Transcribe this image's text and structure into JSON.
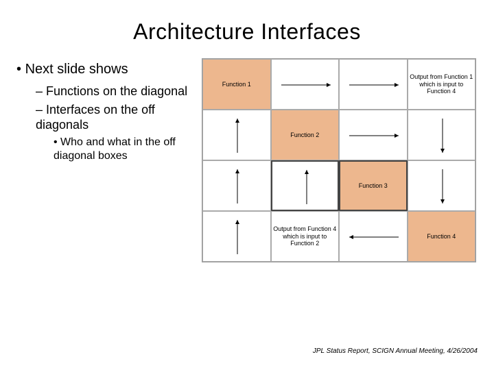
{
  "title": "Architecture Interfaces",
  "bullets": {
    "b1": "Next slide shows",
    "b2a": "Functions on the diagonal",
    "b2b": "Interfaces on the off diagonals",
    "b3": "Who and what in the off diagonal boxes"
  },
  "grid": {
    "f1": "Function 1",
    "f2": "Function 2",
    "f3": "Function 3",
    "f4": "Function 4",
    "out14": "Output from Function 1 which is input to Function 4",
    "out42": "Output from Function 4 which is input to Function 2"
  },
  "footer": "JPL Status Report, SCIGN Annual Meeting, 4/26/2004"
}
